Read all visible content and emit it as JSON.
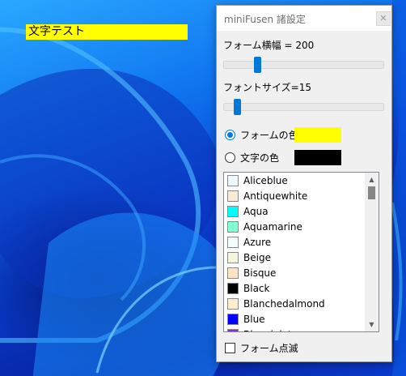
{
  "desktop": {
    "sticky_note_text": "文字テスト",
    "sticky_note_bg": "#ffff00"
  },
  "dialog": {
    "title": "miniFusen 諸設定",
    "close_icon": "close-icon",
    "form_width_label": "フォーム横幅 = 200",
    "form_width_level": 0.2,
    "font_size_label": "フォントサイズ=15",
    "font_size_level": 0.07,
    "form_color_label": "フォームの色",
    "form_color": "#ffff00",
    "form_color_selected": true,
    "text_color_label": "文字の色",
    "text_color": "#000000",
    "colors": [
      {
        "name": "Aliceblue",
        "hex": "#f0f8ff"
      },
      {
        "name": "Antiquewhite",
        "hex": "#faebd7"
      },
      {
        "name": "Aqua",
        "hex": "#00ffff"
      },
      {
        "name": "Aquamarine",
        "hex": "#7fffd4"
      },
      {
        "name": "Azure",
        "hex": "#f0ffff"
      },
      {
        "name": "Beige",
        "hex": "#f5f5dc"
      },
      {
        "name": "Bisque",
        "hex": "#ffe4c4"
      },
      {
        "name": "Black",
        "hex": "#000000"
      },
      {
        "name": "Blanchedalmond",
        "hex": "#ffebcd"
      },
      {
        "name": "Blue",
        "hex": "#0000ff"
      },
      {
        "name": "Blueviolet",
        "hex": "#8a2be2"
      }
    ],
    "blink_label": "フォーム点滅",
    "blink_checked": false
  }
}
